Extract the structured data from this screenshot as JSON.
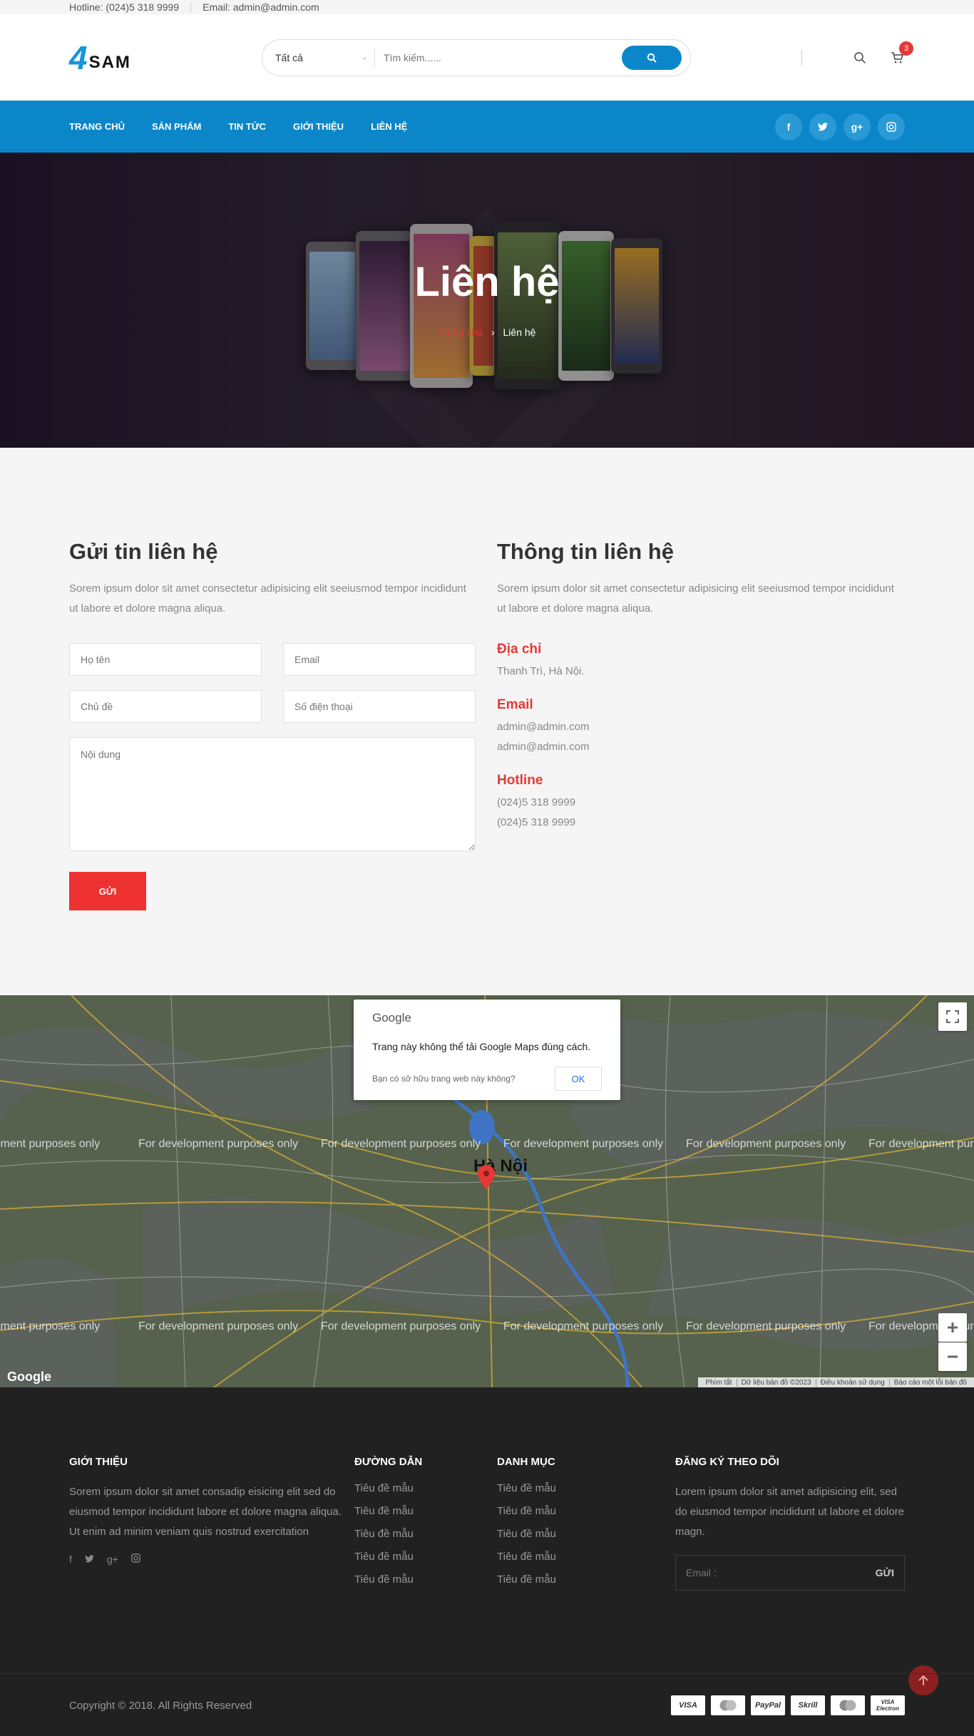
{
  "topbar": {
    "hotline": "Hotline: (024)5 318 9999",
    "email": "Email: admin@admin.com"
  },
  "header": {
    "logo_mark": "4",
    "logo_text": "SAM",
    "search_category": "Tất cả",
    "search_placeholder": "Tìm kiếm......",
    "cart_count": "3"
  },
  "nav": {
    "items": [
      "TRANG CHỦ",
      "SẢN PHẨM",
      "TIN TỨC",
      "GIỚI THIỆU",
      "LIÊN HỆ"
    ],
    "socials": [
      "facebook-icon",
      "twitter-icon",
      "google-plus-icon",
      "instagram-icon"
    ]
  },
  "banner": {
    "title": "Liên hệ",
    "crumb_home": "Trang chủ",
    "crumb_current": "Liên hệ"
  },
  "form": {
    "title": "Gửi tin liên hệ",
    "desc": "Sorem ipsum dolor sit amet consectetur adipisicing elit seeiusmod tempor incididunt ut labore et dolore magna aliqua.",
    "name_placeholder": "Họ tên",
    "email_placeholder": "Email",
    "subject_placeholder": "Chủ đề",
    "phone_placeholder": "Số điện thoại",
    "message_placeholder": "Nội dung",
    "submit": "GỬI"
  },
  "info": {
    "title": "Thông tin liên hệ",
    "desc": "Sorem ipsum dolor sit amet consectetur adipisicing elit seeiusmod tempor incididunt ut labore et dolore magna aliqua.",
    "address_label": "Địa chỉ",
    "address": "Thanh Trì, Hà Nội.",
    "email_label": "Email",
    "emails": [
      "admin@admin.com",
      "admin@admin.com"
    ],
    "hotline_label": "Hotline",
    "phones": [
      "(024)5 318 9999",
      "(024)5 318 9999"
    ]
  },
  "map": {
    "dialog_brand": "Google",
    "dialog_message": "Trang này không thể tải Google Maps đúng cách.",
    "dialog_owner": "Bạn có sở hữu trang web này không?",
    "dialog_ok": "OK",
    "watermark": "For development purposes only",
    "city": "Hà Nội",
    "logo": "Google",
    "terms": [
      "Phím tắt",
      "Dữ liệu bản đồ ©2023",
      "Điều khoản sử dụng",
      "Báo cáo một lỗi bản đồ"
    ]
  },
  "footer": {
    "about_title": "GIỚI THIỆU",
    "about_text": "Sorem ipsum dolor sit amet consadip eisicing elit sed do eiusmod tempor incididunt labore et dolore magna aliqua. Ut enim ad minim veniam quis nostrud exercitation",
    "links_title": "ĐƯỜNG DẪN",
    "links": [
      "Tiêu đề mẫu",
      "Tiêu đề mẫu",
      "Tiêu đề mẫu",
      "Tiêu đề mẫu",
      "Tiêu đề mẫu"
    ],
    "cats_title": "DANH MỤC",
    "cats": [
      "Tiêu đề mẫu",
      "Tiêu đề mẫu",
      "Tiêu đề mẫu",
      "Tiêu đề mẫu",
      "Tiêu đề mẫu"
    ],
    "sub_title": "ĐĂNG KÝ THEO DÕI",
    "sub_text": "Lorem ipsum dolor sit amet adipisicing elit, sed do eiusmod tempor incididunt ut labore et dolore magn.",
    "sub_placeholder": "Email :",
    "sub_button": "GỬI",
    "copyright": "Copyright © 2018. All Rights Reserved",
    "payments": [
      "VISA",
      "MasterCard",
      "PayPal",
      "Skrill",
      "Maestro",
      "VISA Electron"
    ]
  }
}
